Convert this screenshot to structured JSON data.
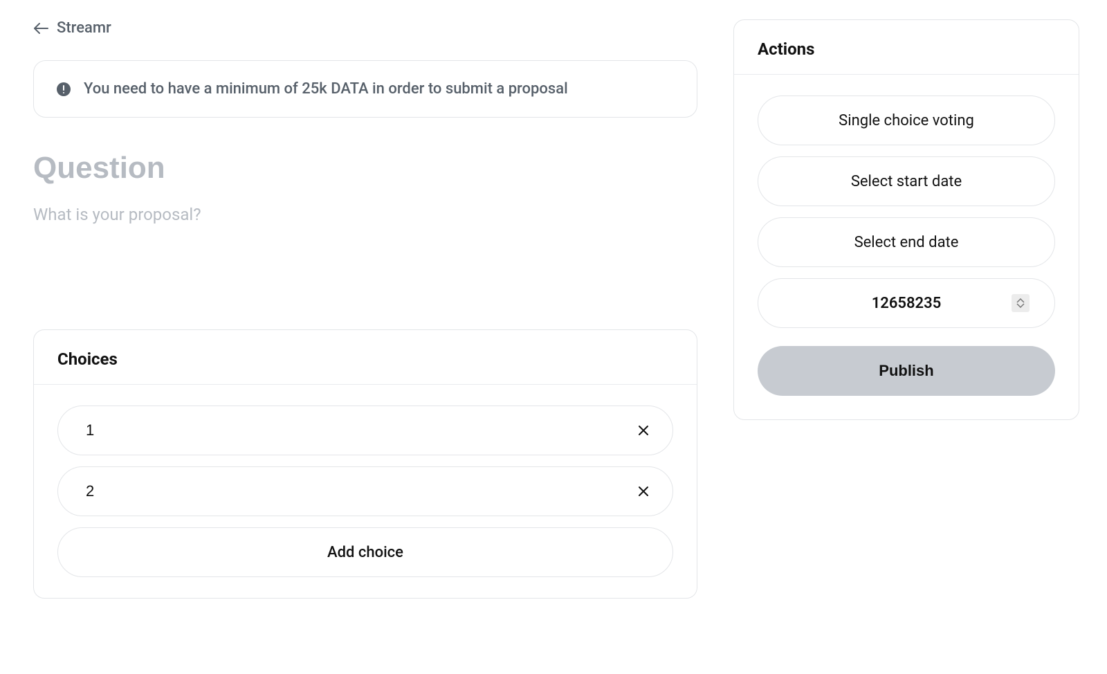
{
  "back": {
    "label": "Streamr"
  },
  "notice": {
    "text": "You need to have a minimum of 25k DATA in order to submit a proposal"
  },
  "editor": {
    "title_placeholder": "Question",
    "body_placeholder": "What is your proposal?"
  },
  "choices": {
    "header": "Choices",
    "items": [
      {
        "value": "1"
      },
      {
        "value": "2"
      }
    ],
    "add_label": "Add choice"
  },
  "actions": {
    "header": "Actions",
    "voting_type": "Single choice voting",
    "start_date": "Select start date",
    "end_date": "Select end date",
    "block_number": "12658235",
    "publish_label": "Publish"
  }
}
